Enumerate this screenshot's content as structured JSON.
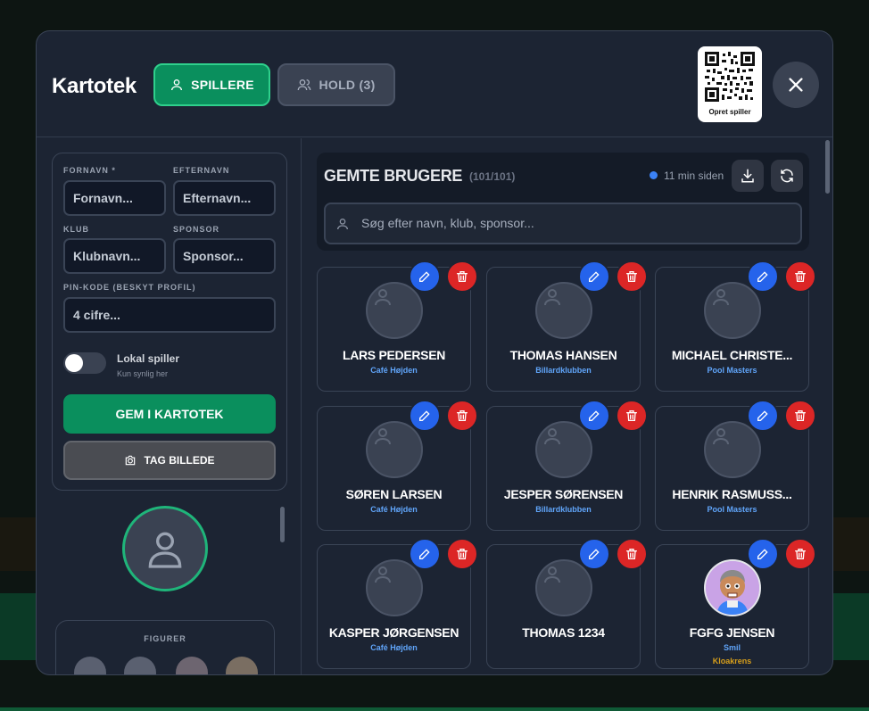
{
  "header": {
    "title": "Kartotek",
    "tabs": [
      {
        "label": "SPILLERE",
        "icon": "user-icon",
        "active": true
      },
      {
        "label": "HOLD (3)",
        "icon": "users-icon",
        "active": false
      }
    ],
    "qr_label": "Opret spiller"
  },
  "form": {
    "first_name_label": "FORNAVN *",
    "first_name_placeholder": "Fornavn...",
    "last_name_label": "EFTERNAVN",
    "last_name_placeholder": "Efternavn...",
    "club_label": "KLUB",
    "club_placeholder": "Klubnavn...",
    "sponsor_label": "SPONSOR",
    "sponsor_placeholder": "Sponsor...",
    "pin_label": "PIN-KODE (BESKYT PROFIL)",
    "pin_placeholder": "4 cifre...",
    "local_label": "Lokal spiller",
    "local_sub": "Kun synlig her",
    "local_on": false,
    "save_label": "GEM I KARTOTEK",
    "photo_label": "TAG BILLEDE"
  },
  "figures": {
    "label": "FIGURER"
  },
  "saved": {
    "title": "GEMTE BRUGERE",
    "count": "(101/101)",
    "status": "11 min siden",
    "search_placeholder": "Søg efter navn, klub, sponsor..."
  },
  "players": [
    {
      "name": "LARS PEDERSEN",
      "club": "Café Højden",
      "sponsor": ""
    },
    {
      "name": "THOMAS HANSEN",
      "club": "Billardklubben",
      "sponsor": ""
    },
    {
      "name": "MICHAEL CHRISTE...",
      "club": "Pool Masters",
      "sponsor": ""
    },
    {
      "name": "SØREN LARSEN",
      "club": "Café Højden",
      "sponsor": ""
    },
    {
      "name": "JESPER SØRENSEN",
      "club": "Billardklubben",
      "sponsor": ""
    },
    {
      "name": "HENRIK RASMUSS...",
      "club": "Pool Masters",
      "sponsor": ""
    },
    {
      "name": "KASPER JØRGENSEN",
      "club": "Café Højden",
      "sponsor": ""
    },
    {
      "name": "THOMAS 1234",
      "club": "",
      "sponsor": ""
    },
    {
      "name": "FGFG JENSEN",
      "club": "Smil",
      "sponsor": "Kloakrens"
    }
  ],
  "colors": {
    "accent": "#0a8f5d",
    "edit": "#2563eb",
    "delete": "#dc2626",
    "club": "#60a5fa",
    "sponsor": "#d69e1b"
  }
}
